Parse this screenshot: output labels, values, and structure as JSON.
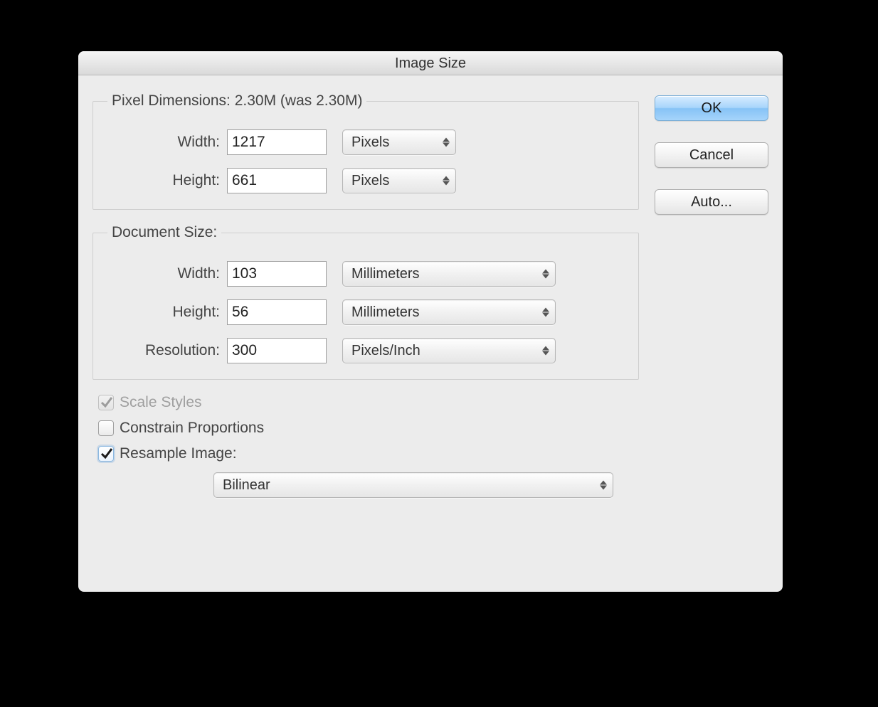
{
  "window": {
    "title": "Image Size"
  },
  "pixelDimensions": {
    "legend": "Pixel Dimensions:  2.30M (was 2.30M)",
    "widthLabel": "Width:",
    "widthValue": "1217",
    "widthUnit": "Pixels",
    "heightLabel": "Height:",
    "heightValue": "661",
    "heightUnit": "Pixels"
  },
  "documentSize": {
    "legend": "Document Size:",
    "widthLabel": "Width:",
    "widthValue": "103",
    "widthUnit": "Millimeters",
    "heightLabel": "Height:",
    "heightValue": "56",
    "heightUnit": "Millimeters",
    "resolutionLabel": "Resolution:",
    "resolutionValue": "300",
    "resolutionUnit": "Pixels/Inch"
  },
  "checkboxes": {
    "scaleStyles": {
      "label": "Scale Styles",
      "checked": true,
      "disabled": true
    },
    "constrainProportions": {
      "label": "Constrain Proportions",
      "checked": false,
      "disabled": false
    },
    "resampleImage": {
      "label": "Resample Image:",
      "checked": true,
      "disabled": false
    }
  },
  "resample": {
    "method": "Bilinear"
  },
  "buttons": {
    "ok": "OK",
    "cancel": "Cancel",
    "auto": "Auto..."
  }
}
